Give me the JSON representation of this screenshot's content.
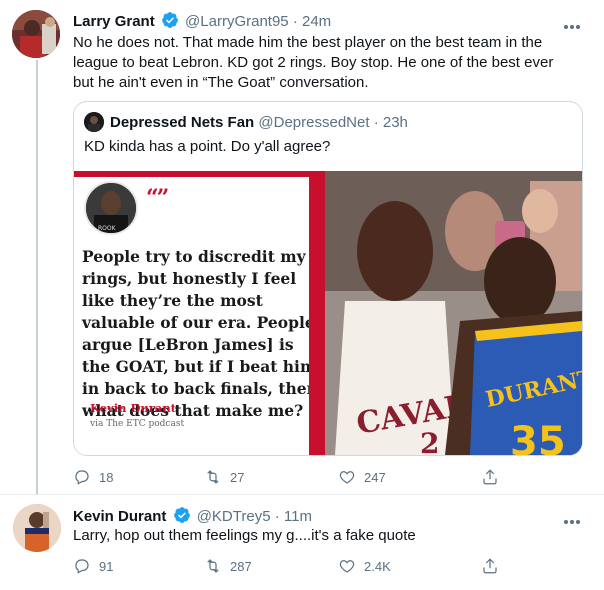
{
  "tweets": [
    {
      "name": "Larry Grant",
      "handle": "@LarryGrant95",
      "time": "· 24m",
      "text": "No he does not.  That made him the best player on the best team in the league to beat Lebron.  KD got 2 rings.  Boy stop.  He one of the best ever but he ain't even in “The Goat” conversation.",
      "quoted": {
        "name": "Depressed Nets Fan",
        "handle": "@DepressedNet",
        "time": "· 23h",
        "text": "KD kinda has a point. Do y'all agree?",
        "card": {
          "quote_mark": "“”",
          "quote": "People try to discredit my rings, but honestly I feel like they’re the most valuable of our era. People argue [LeBron James] is the GOAT, but if I beat him in back to back finals, then what does that make me?",
          "author": "Kevin Durant",
          "source": "via The ETC podcast",
          "jersey_left": "CAVAL",
          "jersey_right": "DURANT",
          "number_right": "35",
          "number_left": "2"
        }
      },
      "actions": {
        "replies": "18",
        "retweets": "27",
        "likes": "247"
      }
    },
    {
      "name": "Kevin Durant",
      "handle": "@KDTrey5",
      "time": "· 11m",
      "text": "Larry, hop out them feelings my g....it's a fake quote",
      "actions": {
        "replies": "91",
        "retweets": "287",
        "likes": "2.4K"
      }
    }
  ],
  "colors": {
    "accent": "#1da1f2",
    "muted": "#5b7083",
    "card_red": "#c8102e"
  },
  "icons": [
    "verified-badge-icon",
    "more-options-icon",
    "reply-icon",
    "retweet-icon",
    "like-icon",
    "share-icon"
  ]
}
